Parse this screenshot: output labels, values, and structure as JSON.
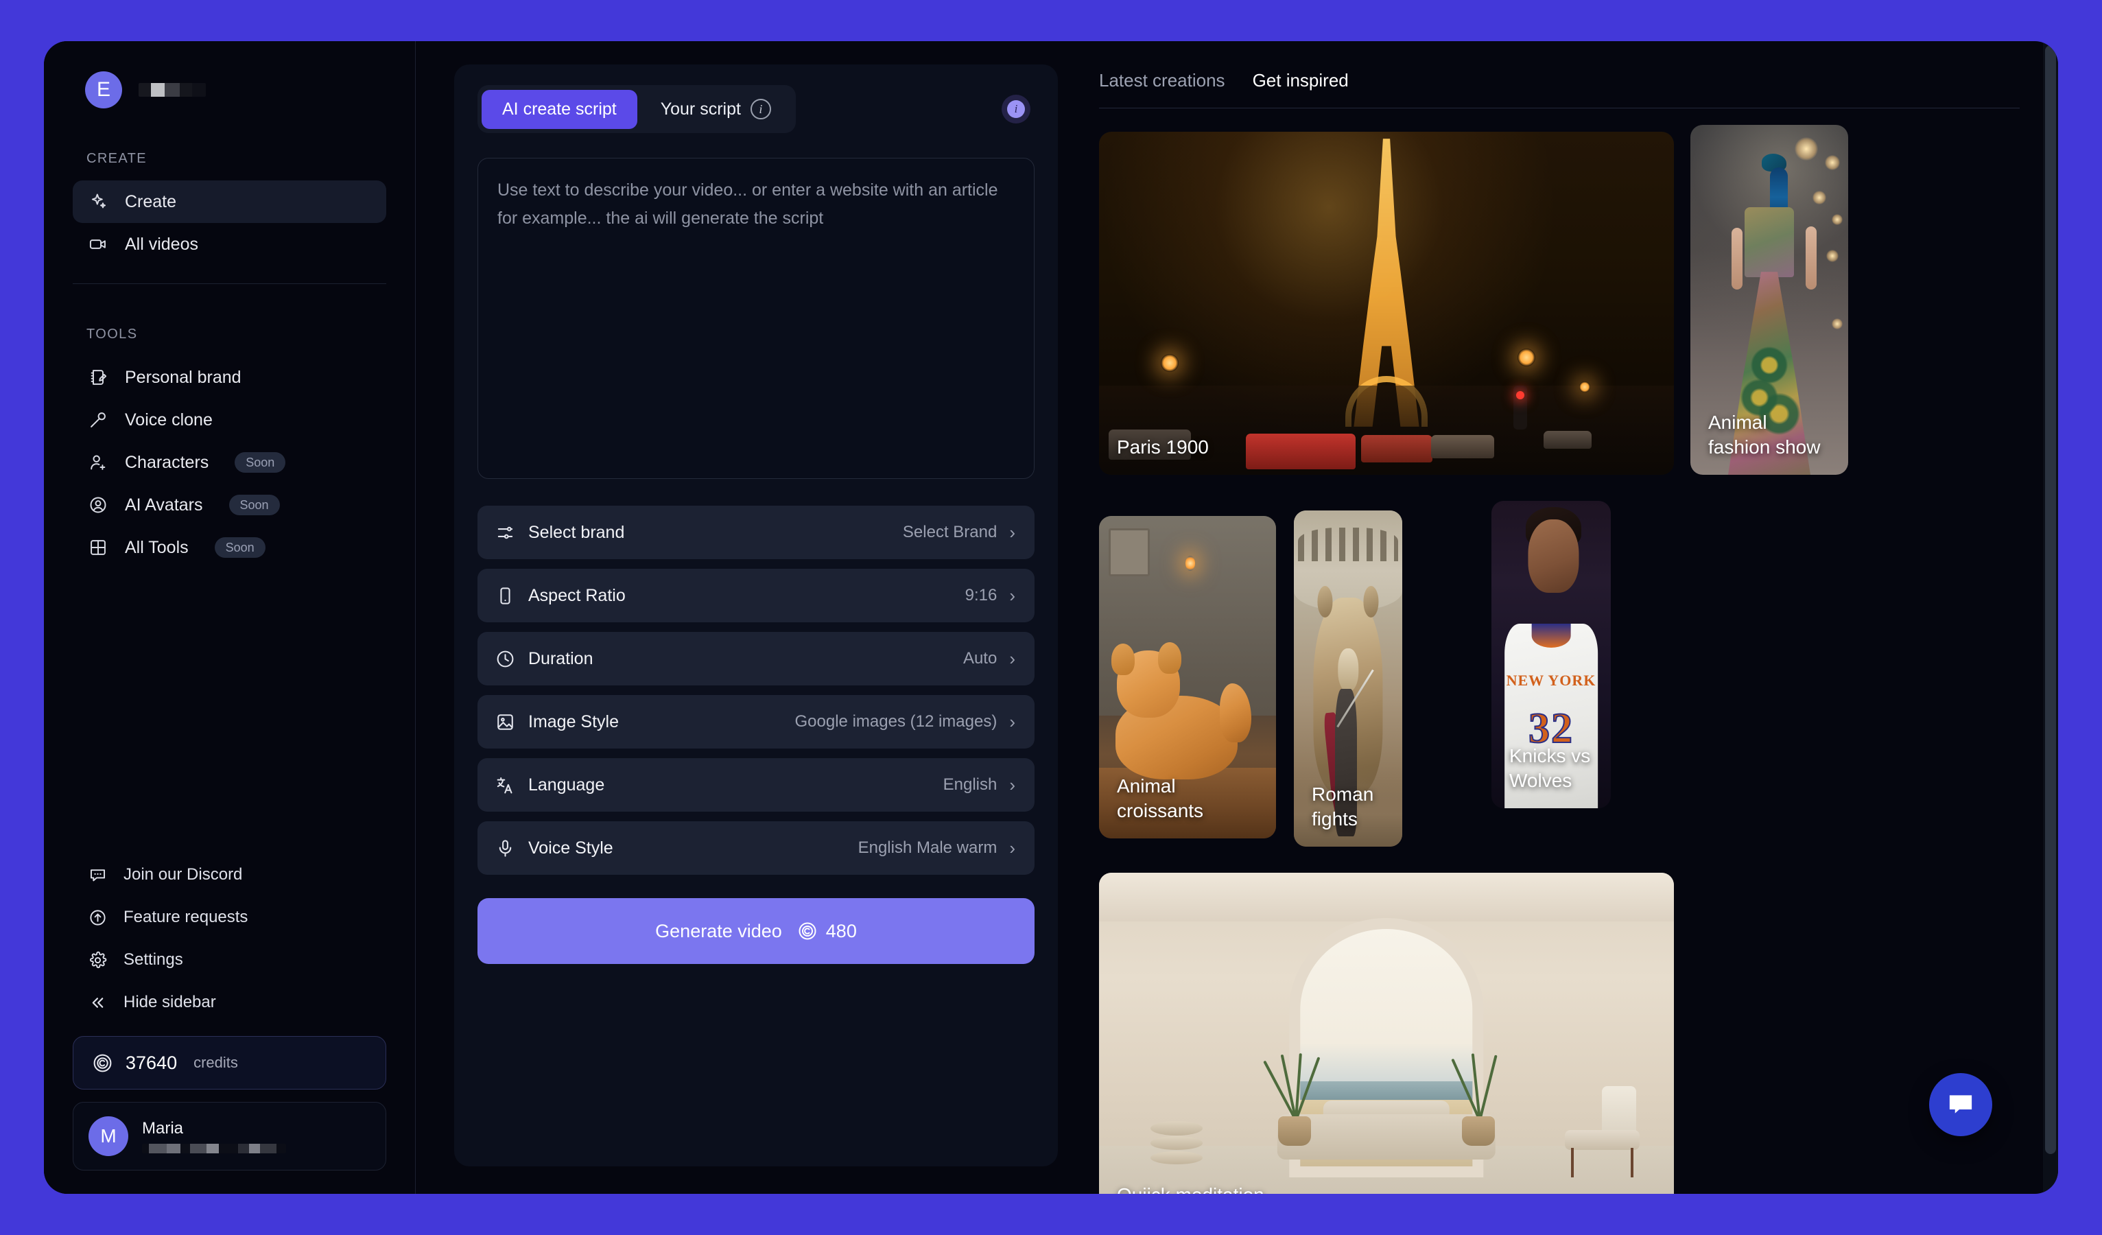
{
  "brand": {
    "avatar_initial": "E",
    "name_redacted": true
  },
  "sidebar": {
    "sections": [
      {
        "label": "CREATE"
      },
      {
        "label": "TOOLS"
      }
    ],
    "create_items": [
      {
        "label": "Create",
        "icon": "sparkle-icon",
        "active": true
      },
      {
        "label": "All videos",
        "icon": "video-camera-icon",
        "active": false
      }
    ],
    "tools_items": [
      {
        "label": "Personal brand",
        "icon": "notebook-pen-icon",
        "badge": ""
      },
      {
        "label": "Voice clone",
        "icon": "microphone-icon",
        "badge": ""
      },
      {
        "label": "Characters",
        "icon": "user-plus-icon",
        "badge": "Soon"
      },
      {
        "label": "AI Avatars",
        "icon": "user-circle-icon",
        "badge": "Soon"
      },
      {
        "label": "All Tools",
        "icon": "grid-icon",
        "badge": "Soon"
      }
    ],
    "footer_items": [
      {
        "label": "Join our Discord",
        "icon": "chat-dots-icon"
      },
      {
        "label": "Feature requests",
        "icon": "arrow-up-circle-icon"
      },
      {
        "label": "Settings",
        "icon": "gear-icon"
      },
      {
        "label": "Hide sidebar",
        "icon": "chevrons-left-icon"
      }
    ],
    "credits": {
      "icon": "credit-coin-icon",
      "value": "37640",
      "unit": "credits"
    },
    "user": {
      "avatar_initial": "M",
      "name": "Maria",
      "email_redacted": true
    }
  },
  "center": {
    "tabs": [
      {
        "label": "AI create script",
        "active": true,
        "info": false
      },
      {
        "label": "Your script",
        "active": false,
        "info": true,
        "info_glyph": "i"
      }
    ],
    "info_badge_glyph": "i",
    "script_placeholder": "Use text to describe your video... or enter a website with an article for example... the ai will generate the script",
    "script_value": "",
    "options": [
      {
        "label": "Select brand",
        "value": "Select Brand",
        "icon": "sliders-icon"
      },
      {
        "label": "Aspect Ratio",
        "value": "9:16",
        "icon": "phone-icon"
      },
      {
        "label": "Duration",
        "value": "Auto",
        "icon": "clock-icon"
      },
      {
        "label": "Image Style",
        "value": "Google images (12 images)",
        "icon": "image-icon"
      },
      {
        "label": "Language",
        "value": "English",
        "icon": "translate-icon"
      },
      {
        "label": "Voice Style",
        "value": "English Male warm",
        "icon": "microphone-icon"
      }
    ],
    "chevron": "›",
    "generate": {
      "label": "Generate video",
      "cost": "480",
      "coin_icon": "credit-coin-icon"
    }
  },
  "gallery": {
    "tabs": [
      {
        "label": "Latest creations",
        "active": false
      },
      {
        "label": "Get inspired",
        "active": true
      }
    ],
    "cards": [
      {
        "caption": "Paris 1900",
        "art": "paris"
      },
      {
        "caption": "Animal\nfashion show",
        "art": "fashion"
      },
      {
        "caption": "Animal\ncroissants",
        "art": "croissant"
      },
      {
        "caption": "Roman fights",
        "art": "roman"
      },
      {
        "caption": "Knicks vs\nWolves",
        "art": "knicks"
      },
      {
        "caption": "Quiick meditation",
        "art": "meditation"
      }
    ]
  },
  "chat_fab": {
    "icon": "chat-bubble-icon"
  },
  "colors": {
    "page_background": "#4338d9",
    "app_background": "#05060f",
    "panel_background": "#0b0f1c",
    "accent": "#5b4ae8",
    "generate_button": "#7b76ef",
    "avatar": "#6c6ce8",
    "option_row": "#1c2233",
    "chat_fab": "#2d3ecf"
  }
}
